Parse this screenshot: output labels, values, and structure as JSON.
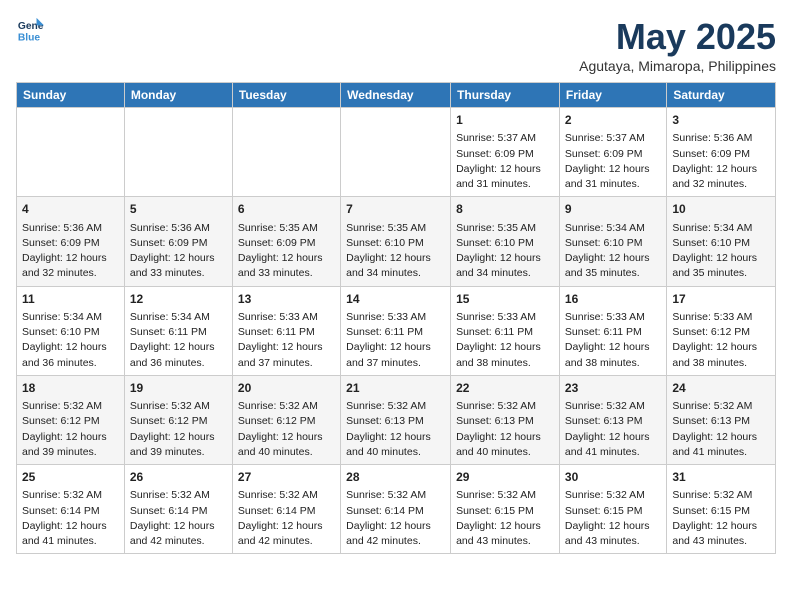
{
  "header": {
    "logo_line1": "General",
    "logo_line2": "Blue",
    "month": "May 2025",
    "location": "Agutaya, Mimaropa, Philippines"
  },
  "days_of_week": [
    "Sunday",
    "Monday",
    "Tuesday",
    "Wednesday",
    "Thursday",
    "Friday",
    "Saturday"
  ],
  "weeks": [
    [
      {
        "day": "",
        "info": ""
      },
      {
        "day": "",
        "info": ""
      },
      {
        "day": "",
        "info": ""
      },
      {
        "day": "",
        "info": ""
      },
      {
        "day": "1",
        "info": "Sunrise: 5:37 AM\nSunset: 6:09 PM\nDaylight: 12 hours\nand 31 minutes."
      },
      {
        "day": "2",
        "info": "Sunrise: 5:37 AM\nSunset: 6:09 PM\nDaylight: 12 hours\nand 31 minutes."
      },
      {
        "day": "3",
        "info": "Sunrise: 5:36 AM\nSunset: 6:09 PM\nDaylight: 12 hours\nand 32 minutes."
      }
    ],
    [
      {
        "day": "4",
        "info": "Sunrise: 5:36 AM\nSunset: 6:09 PM\nDaylight: 12 hours\nand 32 minutes."
      },
      {
        "day": "5",
        "info": "Sunrise: 5:36 AM\nSunset: 6:09 PM\nDaylight: 12 hours\nand 33 minutes."
      },
      {
        "day": "6",
        "info": "Sunrise: 5:35 AM\nSunset: 6:09 PM\nDaylight: 12 hours\nand 33 minutes."
      },
      {
        "day": "7",
        "info": "Sunrise: 5:35 AM\nSunset: 6:10 PM\nDaylight: 12 hours\nand 34 minutes."
      },
      {
        "day": "8",
        "info": "Sunrise: 5:35 AM\nSunset: 6:10 PM\nDaylight: 12 hours\nand 34 minutes."
      },
      {
        "day": "9",
        "info": "Sunrise: 5:34 AM\nSunset: 6:10 PM\nDaylight: 12 hours\nand 35 minutes."
      },
      {
        "day": "10",
        "info": "Sunrise: 5:34 AM\nSunset: 6:10 PM\nDaylight: 12 hours\nand 35 minutes."
      }
    ],
    [
      {
        "day": "11",
        "info": "Sunrise: 5:34 AM\nSunset: 6:10 PM\nDaylight: 12 hours\nand 36 minutes."
      },
      {
        "day": "12",
        "info": "Sunrise: 5:34 AM\nSunset: 6:11 PM\nDaylight: 12 hours\nand 36 minutes."
      },
      {
        "day": "13",
        "info": "Sunrise: 5:33 AM\nSunset: 6:11 PM\nDaylight: 12 hours\nand 37 minutes."
      },
      {
        "day": "14",
        "info": "Sunrise: 5:33 AM\nSunset: 6:11 PM\nDaylight: 12 hours\nand 37 minutes."
      },
      {
        "day": "15",
        "info": "Sunrise: 5:33 AM\nSunset: 6:11 PM\nDaylight: 12 hours\nand 38 minutes."
      },
      {
        "day": "16",
        "info": "Sunrise: 5:33 AM\nSunset: 6:11 PM\nDaylight: 12 hours\nand 38 minutes."
      },
      {
        "day": "17",
        "info": "Sunrise: 5:33 AM\nSunset: 6:12 PM\nDaylight: 12 hours\nand 38 minutes."
      }
    ],
    [
      {
        "day": "18",
        "info": "Sunrise: 5:32 AM\nSunset: 6:12 PM\nDaylight: 12 hours\nand 39 minutes."
      },
      {
        "day": "19",
        "info": "Sunrise: 5:32 AM\nSunset: 6:12 PM\nDaylight: 12 hours\nand 39 minutes."
      },
      {
        "day": "20",
        "info": "Sunrise: 5:32 AM\nSunset: 6:12 PM\nDaylight: 12 hours\nand 40 minutes."
      },
      {
        "day": "21",
        "info": "Sunrise: 5:32 AM\nSunset: 6:13 PM\nDaylight: 12 hours\nand 40 minutes."
      },
      {
        "day": "22",
        "info": "Sunrise: 5:32 AM\nSunset: 6:13 PM\nDaylight: 12 hours\nand 40 minutes."
      },
      {
        "day": "23",
        "info": "Sunrise: 5:32 AM\nSunset: 6:13 PM\nDaylight: 12 hours\nand 41 minutes."
      },
      {
        "day": "24",
        "info": "Sunrise: 5:32 AM\nSunset: 6:13 PM\nDaylight: 12 hours\nand 41 minutes."
      }
    ],
    [
      {
        "day": "25",
        "info": "Sunrise: 5:32 AM\nSunset: 6:14 PM\nDaylight: 12 hours\nand 41 minutes."
      },
      {
        "day": "26",
        "info": "Sunrise: 5:32 AM\nSunset: 6:14 PM\nDaylight: 12 hours\nand 42 minutes."
      },
      {
        "day": "27",
        "info": "Sunrise: 5:32 AM\nSunset: 6:14 PM\nDaylight: 12 hours\nand 42 minutes."
      },
      {
        "day": "28",
        "info": "Sunrise: 5:32 AM\nSunset: 6:14 PM\nDaylight: 12 hours\nand 42 minutes."
      },
      {
        "day": "29",
        "info": "Sunrise: 5:32 AM\nSunset: 6:15 PM\nDaylight: 12 hours\nand 43 minutes."
      },
      {
        "day": "30",
        "info": "Sunrise: 5:32 AM\nSunset: 6:15 PM\nDaylight: 12 hours\nand 43 minutes."
      },
      {
        "day": "31",
        "info": "Sunrise: 5:32 AM\nSunset: 6:15 PM\nDaylight: 12 hours\nand 43 minutes."
      }
    ]
  ]
}
